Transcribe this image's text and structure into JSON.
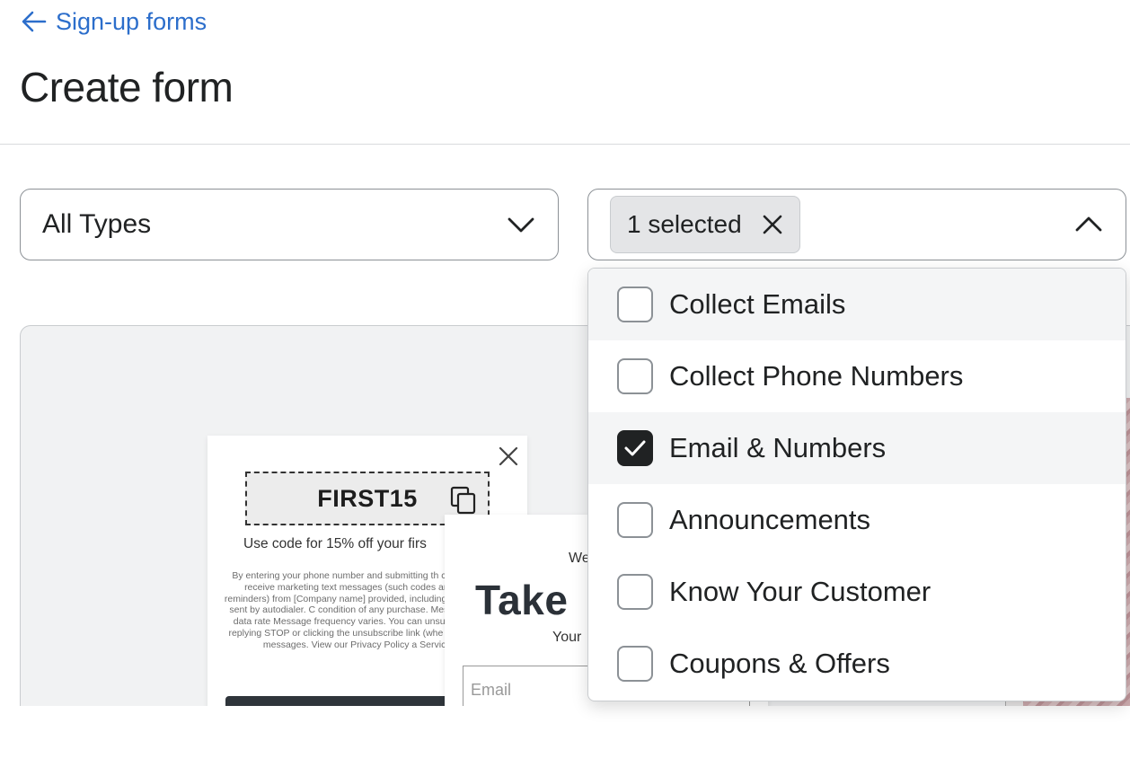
{
  "breadcrumb": {
    "back_label": "Sign-up forms"
  },
  "page": {
    "title": "Create form"
  },
  "type_filter": {
    "value": "All Types"
  },
  "goal_filter": {
    "selected_tag": "1 selected",
    "options": [
      {
        "label": "Collect Emails",
        "checked": false
      },
      {
        "label": "Collect Phone Numbers",
        "checked": false
      },
      {
        "label": "Email & Numbers",
        "checked": true
      },
      {
        "label": "Announcements",
        "checked": false
      },
      {
        "label": "Know Your Customer",
        "checked": false
      },
      {
        "label": "Coupons & Offers",
        "checked": false
      }
    ]
  },
  "preview_card_1": {
    "coupon_code": "FIRST15",
    "offer_text": "Use code for 15% off your firs",
    "legal_text": "By entering your phone number and submitting th consent to receive marketing text messages (such codes and cart reminders) from [Company name] provided, including messages sent by autodialer. C condition of any purchase. Message and data rate Message frequency varies. You can unsubscribe a replying STOP or clicking the unsubscribe link (whe one of our messages. View our Privacy Policy a Service."
  },
  "preview_card_2": {
    "eyebrow": "We",
    "headline": "Take",
    "sub": "Your",
    "email_placeholder": "Email"
  },
  "colors": {
    "link": "#2c6ecb",
    "text": "#202223",
    "checkbox_on": "#202223"
  }
}
